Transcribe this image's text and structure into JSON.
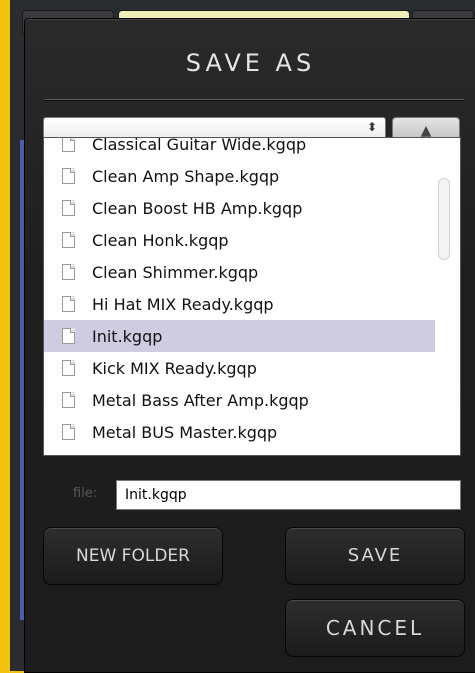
{
  "dialog": {
    "title": "SAVE AS",
    "path_value": "",
    "select_arrows": "⬍",
    "up_icon": "▲"
  },
  "files": [
    {
      "name": "Classical Guitar Wide.kgqp",
      "selected": false
    },
    {
      "name": "Clean Amp Shape.kgqp",
      "selected": false
    },
    {
      "name": "Clean Boost HB Amp.kgqp",
      "selected": false
    },
    {
      "name": "Clean Honk.kgqp",
      "selected": false
    },
    {
      "name": "Clean Shimmer.kgqp",
      "selected": false
    },
    {
      "name": "Hi Hat MIX Ready.kgqp",
      "selected": false
    },
    {
      "name": "Init.kgqp",
      "selected": true
    },
    {
      "name": "Kick MIX Ready.kgqp",
      "selected": false
    },
    {
      "name": "Metal Bass After Amp.kgqp",
      "selected": false
    },
    {
      "name": "Metal BUS Master.kgqp",
      "selected": false
    }
  ],
  "file_field": {
    "label": "file:",
    "value": "Init.kgqp"
  },
  "buttons": {
    "new_folder": "NEW FOLDER",
    "save": "SAVE",
    "cancel": "CANCEL"
  },
  "colors": {
    "background": "#f2c20c",
    "dialog": "#1e1e1e",
    "selected_row": "#cfcce2"
  }
}
